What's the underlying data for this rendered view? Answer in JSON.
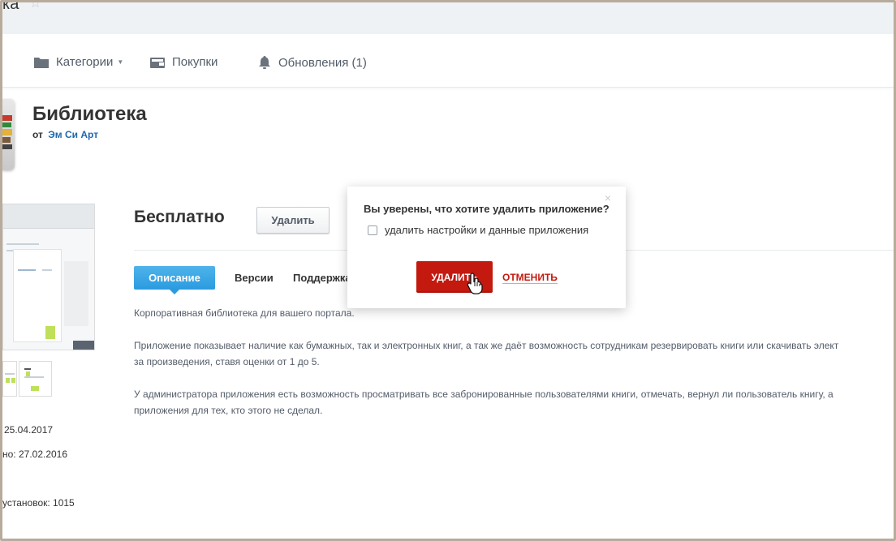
{
  "window": {
    "title_fragment": "ка",
    "star_icon": "star-outline-icon"
  },
  "nav": {
    "categories_label": "Категории",
    "purchases_label": "Покупки",
    "updates_label": "Обновления (1)"
  },
  "app": {
    "title": "Библиотека",
    "author_prefix": "от",
    "author": "Эм Си Арт",
    "price": "Бесплатно",
    "remove_label": "Удалить"
  },
  "tabs": [
    "Описание",
    "Версии",
    "Поддержка"
  ],
  "description": [
    "Корпоративная библиотека для вашего портала.",
    "Приложение показывает наличие как бумажных, так и электронных книг, а так же даёт возможность сотрудникам резервировать книги или скачивать элект",
    "за произведения, ставя оценки от 1 до 5.",
    "У администратора приложения есть возможность просматривать все забронированные пользователями книги, отмечать, вернул ли пользователь книгу, а",
    "приложения для тех, кто этого не сделал."
  ],
  "meta": {
    "updated": "25.04.2017",
    "published": "но: 27.02.2016",
    "installs": "установок: 1015"
  },
  "dialog": {
    "question": "Вы уверены, что хотите удалить приложение?",
    "checkbox_label": "удалить настройки и данные приложения",
    "checkbox_checked": false,
    "confirm_label": "УДАЛИТЬ",
    "cancel_label": "ОТМЕНИТЬ",
    "close_glyph": "×"
  },
  "colors": {
    "accent_blue": "#2a9be0",
    "danger_red": "#c3190f",
    "link_blue": "#2067b0"
  }
}
